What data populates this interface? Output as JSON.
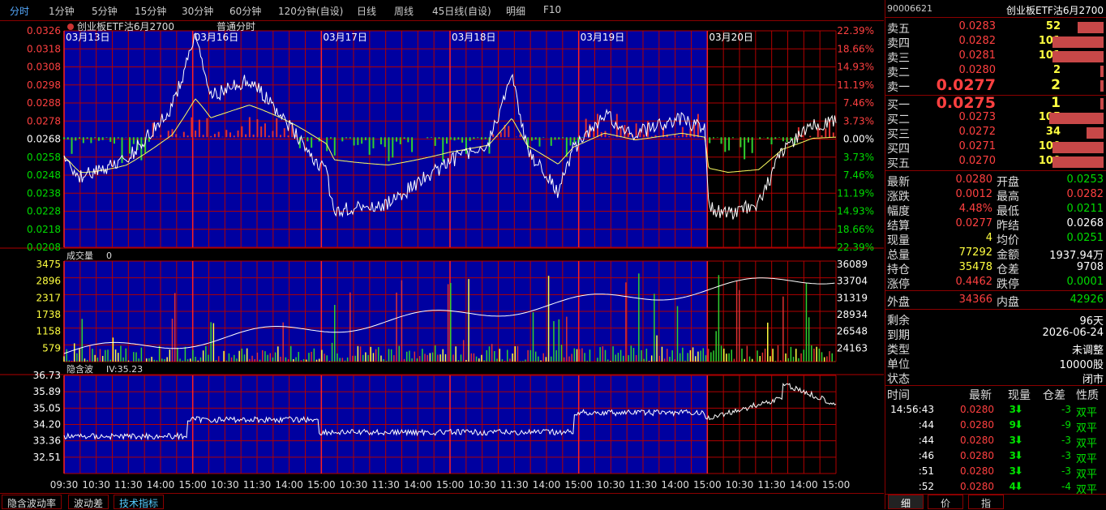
{
  "toolbar": {
    "tabs": [
      "分时",
      "1分钟",
      "5分钟",
      "15分钟",
      "30分钟",
      "60分钟",
      "120分钟(自设)",
      "日线",
      "周线",
      "45日线(自设)",
      "明细",
      "F10"
    ],
    "active": 0
  },
  "chart": {
    "title": "创业板ETF沽6月2700",
    "mode": "普通分时",
    "dates": [
      "03月13日",
      "03月16日",
      "03月17日",
      "03月18日",
      "03月19日",
      "03月20日"
    ],
    "price_left_ticks": [
      "0.0326",
      "0.0318",
      "0.0308",
      "0.0298",
      "0.0288",
      "0.0278",
      "0.0268",
      "0.0258",
      "0.0248",
      "0.0238",
      "0.0228",
      "0.0218",
      "0.0208"
    ],
    "price_right_ticks": [
      "22.39%",
      "18.66%",
      "14.93%",
      "11.19%",
      "7.46%",
      "3.73%",
      "0.00%",
      "3.73%",
      "7.46%",
      "11.19%",
      "14.93%",
      "18.66%",
      "22.39%"
    ],
    "volume_label": "成交量",
    "volume_value": "0",
    "volume_left_ticks": [
      "3475",
      "2896",
      "2317",
      "1738",
      "1158",
      "579"
    ],
    "volume_right_ticks": [
      "36089",
      "33704",
      "31319",
      "28934",
      "26548",
      "24163"
    ],
    "iv_label": "隐含波",
    "iv_value": "IV:35.23",
    "iv_ticks": [
      "36.73",
      "35.89",
      "35.05",
      "34.20",
      "33.36",
      "32.51"
    ],
    "time_ticks": [
      "09:30",
      "10:30",
      "11:30",
      "14:00",
      "15:00",
      "10:30",
      "11:30",
      "14:00",
      "15:00",
      "10:30",
      "11:30",
      "14:00",
      "15:00",
      "10:30",
      "11:30",
      "14:00",
      "15:00",
      "10:30",
      "11:30",
      "14:00",
      "15:00",
      "10:30",
      "11:30",
      "14:00",
      "15:00"
    ]
  },
  "bottom_tabs": [
    "隐含波动率",
    "波动差",
    "技术指标"
  ],
  "panel": {
    "code": "90006621",
    "name": "创业板ETF沽6月2700",
    "asks": [
      {
        "label": "卖五",
        "price": "0.0283",
        "qty": "52",
        "bar": 0.17
      },
      {
        "label": "卖四",
        "price": "0.0282",
        "qty": "101",
        "bar": 0.33
      },
      {
        "label": "卖三",
        "price": "0.0281",
        "qty": "101",
        "bar": 0.33
      },
      {
        "label": "卖二",
        "price": "0.0280",
        "qty": "2",
        "bar": 0.01
      },
      {
        "label": "卖一",
        "price": "0.0277",
        "qty": "2",
        "bar": 0.01
      }
    ],
    "bids": [
      {
        "label": "买一",
        "price": "0.0275",
        "qty": "1",
        "bar": 0.005
      },
      {
        "label": "买二",
        "price": "0.0273",
        "qty": "105",
        "bar": 0.35
      },
      {
        "label": "买三",
        "price": "0.0272",
        "qty": "34",
        "bar": 0.11
      },
      {
        "label": "买四",
        "price": "0.0271",
        "qty": "100",
        "bar": 0.33
      },
      {
        "label": "买五",
        "price": "0.0270",
        "qty": "100",
        "bar": 0.33
      }
    ],
    "stats": [
      [
        "最新",
        "0.0280",
        "开盘",
        "0.0253"
      ],
      [
        "涨跌",
        "0.0012",
        "最高",
        "0.0282"
      ],
      [
        "幅度",
        "4.48%",
        "最低",
        "0.0211"
      ],
      [
        "结算",
        "0.0277",
        "昨结",
        "0.0268"
      ],
      [
        "现量",
        "4",
        "均价",
        "0.0251"
      ],
      [
        "总量",
        "77292",
        "金额",
        "1937.94万"
      ],
      [
        "持仓",
        "35478",
        "仓差",
        "9708"
      ],
      [
        "涨停",
        "0.4462",
        "跌停",
        "0.0001"
      ]
    ],
    "outer": {
      "label": "外盘",
      "value": "34366",
      "label2": "内盘",
      "value2": "42926"
    },
    "info": [
      [
        "剩余",
        "96天"
      ],
      [
        "到期",
        "2026-06-24"
      ],
      [
        "类型",
        "未调整"
      ],
      [
        "单位",
        "10000股"
      ],
      [
        "状态",
        "闭市"
      ]
    ],
    "trade_header": [
      "时间",
      "最新",
      "现量",
      "仓差",
      "性质"
    ],
    "trades": [
      [
        "14:56:43",
        "0.0280",
        "3",
        "-3",
        "双平"
      ],
      [
        ":44",
        "0.0280",
        "9",
        "-9",
        "双平"
      ],
      [
        ":44",
        "0.0280",
        "3",
        "-3",
        "双平"
      ],
      [
        ":46",
        "0.0280",
        "3",
        "-3",
        "双平"
      ],
      [
        ":51",
        "0.0280",
        "3",
        "-3",
        "双平"
      ],
      [
        ":52",
        "0.0280",
        "4",
        "-4",
        "双平"
      ]
    ],
    "tabs": [
      "细",
      "价",
      "指"
    ]
  },
  "colors": {
    "up": "#ff4040",
    "down": "#00dd00",
    "grid": "#b00000",
    "bg_blue": "#0000a0",
    "bar": "#c84848"
  }
}
